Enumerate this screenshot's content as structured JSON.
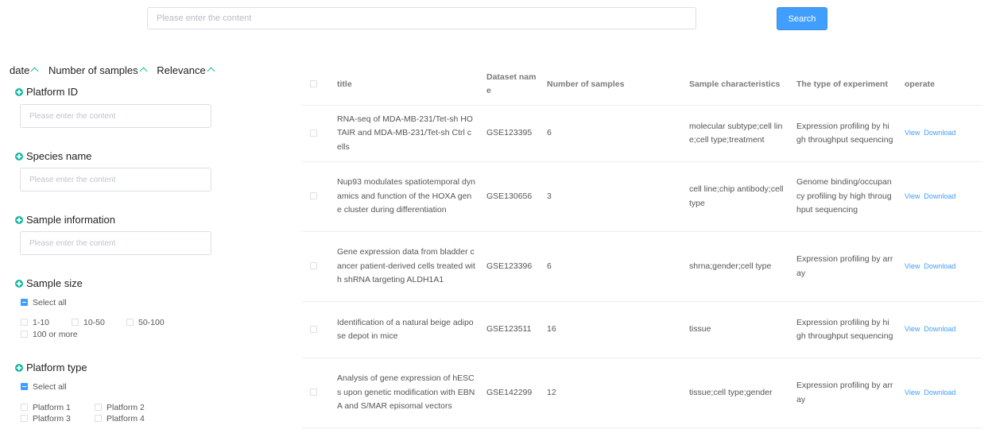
{
  "search": {
    "placeholder": "Please enter the content",
    "button": "Search"
  },
  "sort": [
    {
      "label": "date"
    },
    {
      "label": "Number of samples"
    },
    {
      "label": "Relevance"
    }
  ],
  "filters": {
    "platform_id": {
      "title": "Platform ID",
      "placeholder": "Please enter the content"
    },
    "species_name": {
      "title": "Species name",
      "placeholder": "Please enter the content"
    },
    "sample_information": {
      "title": "Sample information",
      "placeholder": "Please enter the content"
    },
    "sample_size": {
      "title": "Sample size",
      "select_all": "Select all",
      "options": [
        "1-10",
        "10-50",
        "50-100",
        "100 or more"
      ]
    },
    "platform_type": {
      "title": "Platform type",
      "select_all": "Select all",
      "options": [
        "Platform 1",
        "Platform 2",
        "Platform 3",
        "Platform 4"
      ]
    }
  },
  "table": {
    "columns": [
      "title",
      "Dataset name",
      "Number of samples",
      "Sample characteristics",
      "The type of experiment",
      "operate"
    ],
    "rows": [
      {
        "title": "RNA-seq of MDA-MB-231/Tet-sh HOTAIR and MDA-MB-231/Tet-sh Ctrl cells",
        "dataset": "GSE123395",
        "samples": "6",
        "characteristics": "molecular subtype;cell line;cell type;treatment",
        "experiment": "Expression profiling by high throughput sequencing",
        "view": "View",
        "download": "Download"
      },
      {
        "title": "Nup93 modulates spatiotemporal dynamics and function of the HOXA gene cluster during differentiation",
        "dataset": "GSE130656",
        "samples": "3",
        "characteristics": "cell line;chip antibody;cell type",
        "experiment": "Genome binding/occupancy profiling by high throughput sequencing",
        "view": "View",
        "download": "Download"
      },
      {
        "title": "Gene expression data from bladder cancer patient-derived cells treated with shRNA targeting ALDH1A1",
        "dataset": "GSE123396",
        "samples": "6",
        "characteristics": "shrna;gender;cell type",
        "experiment": "Expression profiling by array",
        "view": "View",
        "download": "Download"
      },
      {
        "title": "Identification of a natural beige adipose depot in mice",
        "dataset": "GSE123511",
        "samples": "16",
        "characteristics": "tissue",
        "experiment": "Expression profiling by high throughput sequencing",
        "view": "View",
        "download": "Download"
      },
      {
        "title": "Analysis of gene expression of hESCs upon genetic modification with EBNA and S/MAR episomal vectors",
        "dataset": "GSE142299",
        "samples": "12",
        "characteristics": "tissue;cell type;gender",
        "experiment": "Expression profiling by array",
        "view": "View",
        "download": "Download"
      }
    ]
  },
  "colors": {
    "accent": "#409eff",
    "icon": "#19b8a0",
    "border": "#ebeef5"
  }
}
